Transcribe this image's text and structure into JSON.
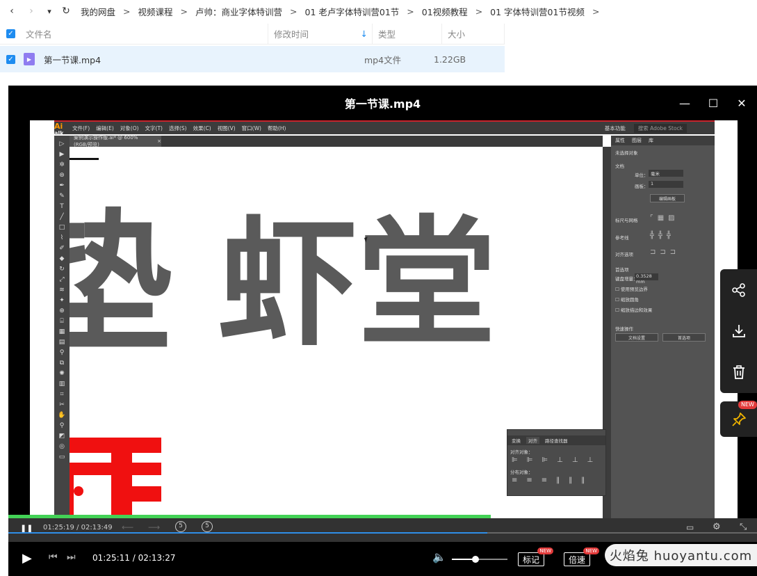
{
  "nav": {
    "back": "‹",
    "forward": "›",
    "dropdown": "▾",
    "refresh": "↻",
    "crumbs": [
      "我的网盘",
      "视频课程",
      "卢帅：商业字体特训营",
      "01 老卢字体特训营01节",
      "01视频教程",
      "01 字体特训营01节视频"
    ],
    "sep": ">"
  },
  "list": {
    "col_name": "文件名",
    "col_modified": "修改时间",
    "col_type": "类型",
    "col_size": "大小",
    "sort_arrow": "↓",
    "file": {
      "name": "第一节课.mp4",
      "type": "mp4文件",
      "size": "1.22GB"
    }
  },
  "player": {
    "title": "第一节课.mp4",
    "inner_time": "01:25:19 / 02:13:49",
    "time": "01:25:11 / 02:13:27",
    "mark_label": "标记",
    "speed_label": "倍速",
    "new_tag": "NEW",
    "pin_new": "NEW",
    "volume": 0.42,
    "progress": 0.64
  },
  "ai": {
    "logo_top": "Ai",
    "logo_bottom": "alk",
    "menus": [
      "文件(F)",
      "编辑(E)",
      "对象(O)",
      "文字(T)",
      "选择(S)",
      "效果(C)",
      "视图(V)",
      "窗口(W)",
      "帮助(H)"
    ],
    "workspace": "基本功能",
    "search": "搜索 Adobe Stock",
    "doc_tab": "案例演示操作版.ai* @ 600% (RGB/预览)",
    "panel_tabs": [
      "属性",
      "图层",
      "库"
    ],
    "no_selection": "未选择对象",
    "doc_label": "文档",
    "unit_label": "单位：",
    "unit_value": "毫米",
    "artboard_label": "画板：",
    "artboard_value": "1",
    "edit_artboard": "编辑画板",
    "rulers_label": "标尺与网格",
    "guides_label": "参考线",
    "snap_label": "对齐选项",
    "prefs_label": "首选项",
    "keyboard_label": "键盘增量：",
    "keyboard_value": "0.3528 mm",
    "opt1": "使用预览边界",
    "opt2": "缩放圆角",
    "opt3": "缩放描边和效果",
    "quick_label": "快速操作",
    "doc_setup": "文档设置",
    "prefs_btn": "首选项",
    "align_tabs": [
      "变换",
      "对齐",
      "路径查找器"
    ],
    "align_objects": "对齐对象：",
    "distribute_objects": "分布对象：",
    "glyphs": [
      "虾",
      "堂"
    ]
  },
  "watermark": "火焰兔 huoyantu.com"
}
